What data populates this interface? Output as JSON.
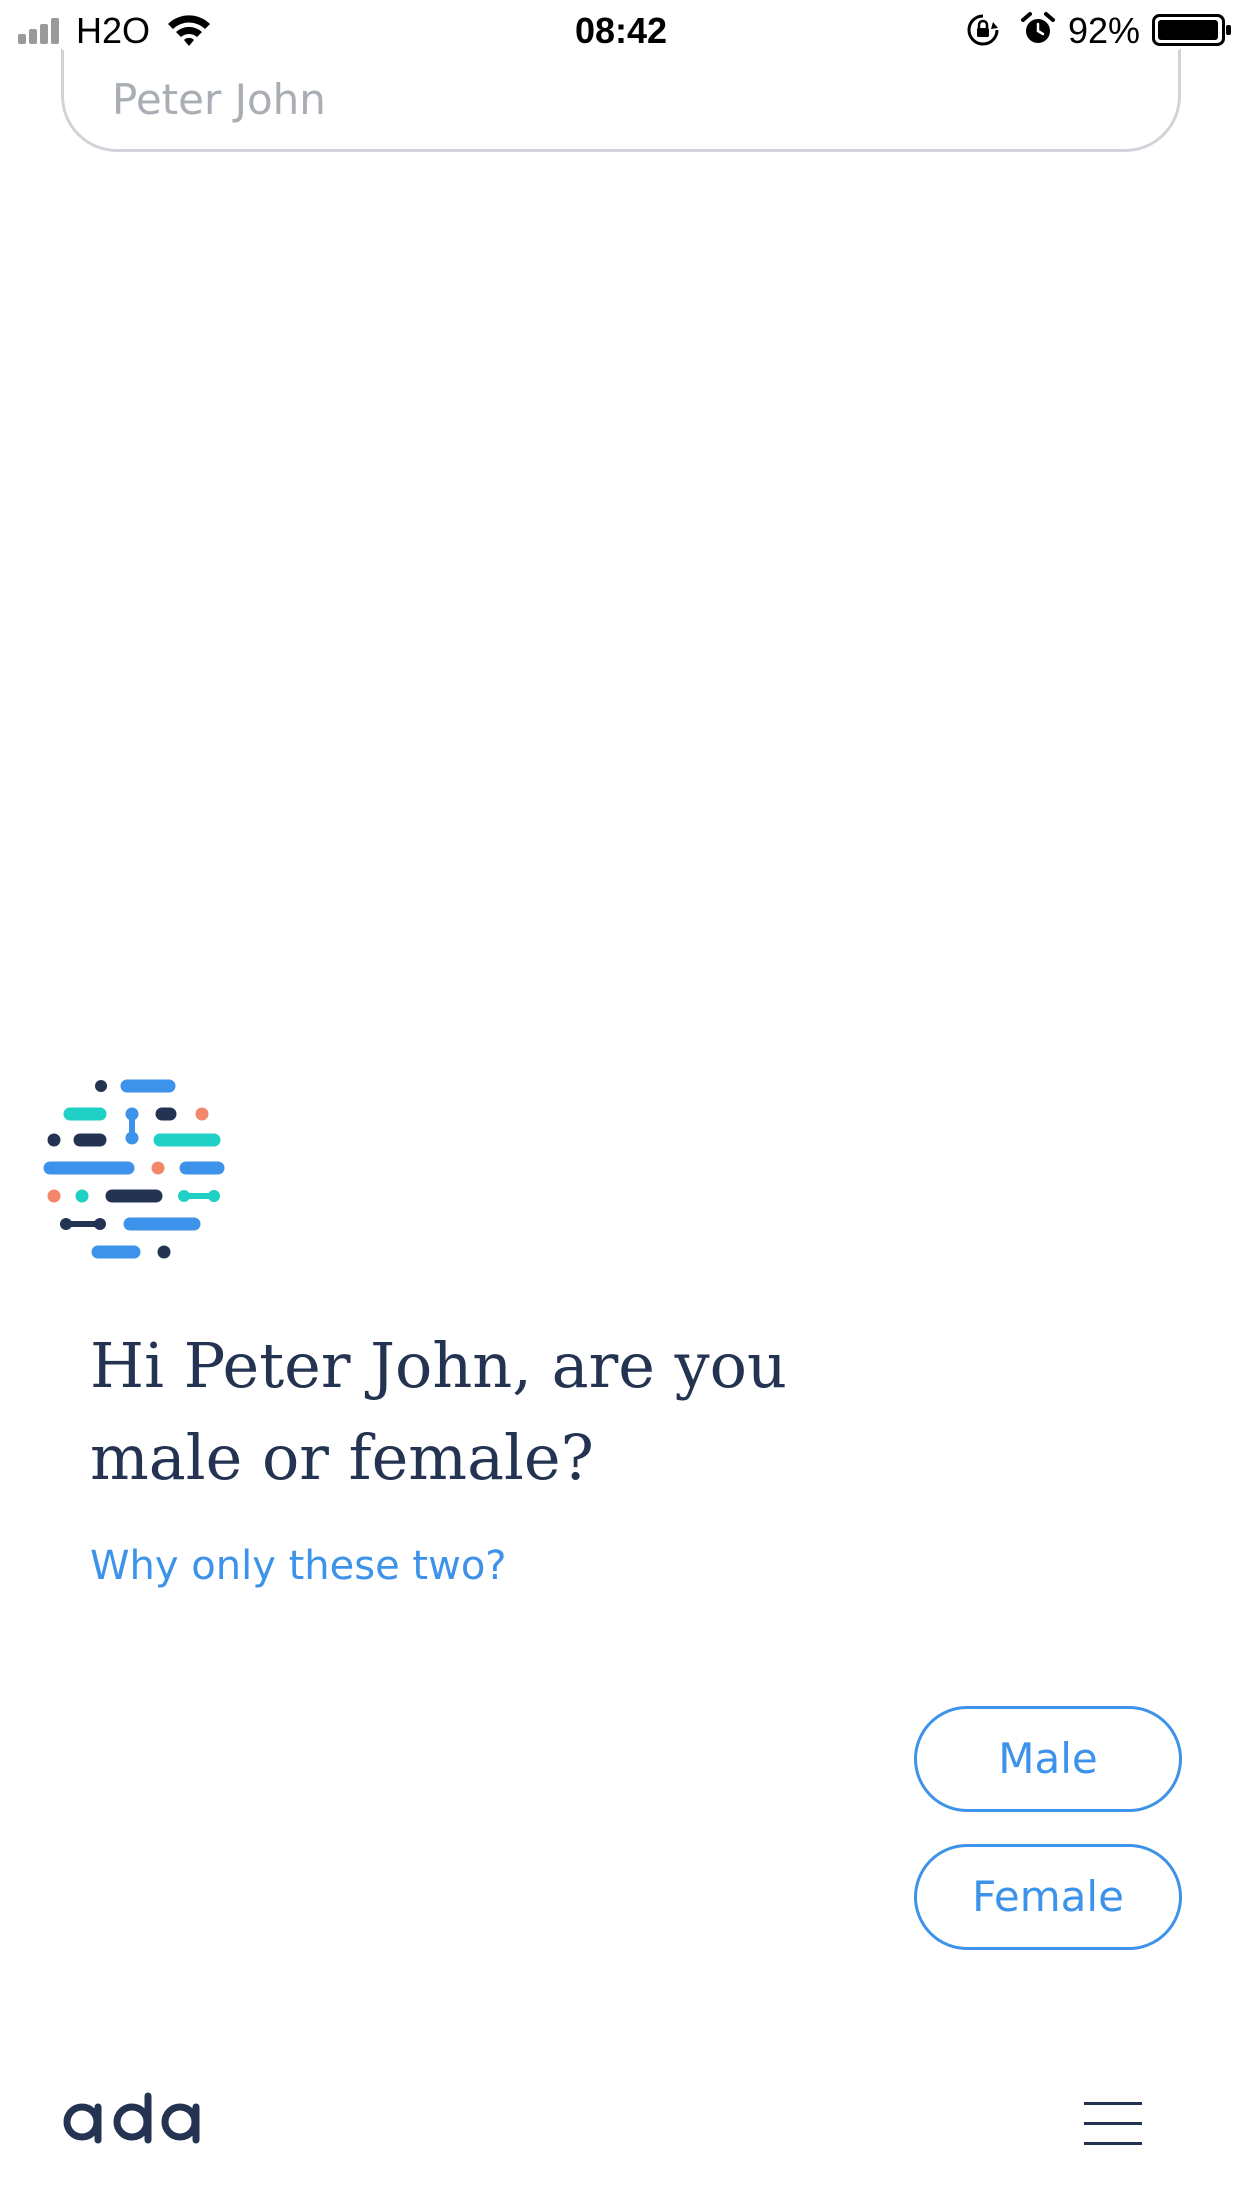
{
  "status_bar": {
    "carrier": "H2O",
    "time": "08:42",
    "battery_percent": "92%",
    "icons": [
      "signal-icon",
      "wifi-icon",
      "rotation-lock-icon",
      "alarm-icon",
      "battery-icon"
    ]
  },
  "name_input": {
    "placeholder": "Peter John"
  },
  "chat": {
    "question_line1": "Hi Peter John, are you",
    "question_line2": "male or female?",
    "why_link": "Why only these two?"
  },
  "answers": {
    "male": "Male",
    "female": "Female"
  },
  "footer": {
    "logo_text": "ada",
    "menu_icon": "hamburger-menu-icon"
  },
  "colors": {
    "accent_blue": "#3d92ea",
    "navy": "#243352",
    "teal": "#1fd1c4",
    "coral": "#f2876c",
    "input_border": "#d0d3d8",
    "placeholder_gray": "#a9adb4"
  }
}
